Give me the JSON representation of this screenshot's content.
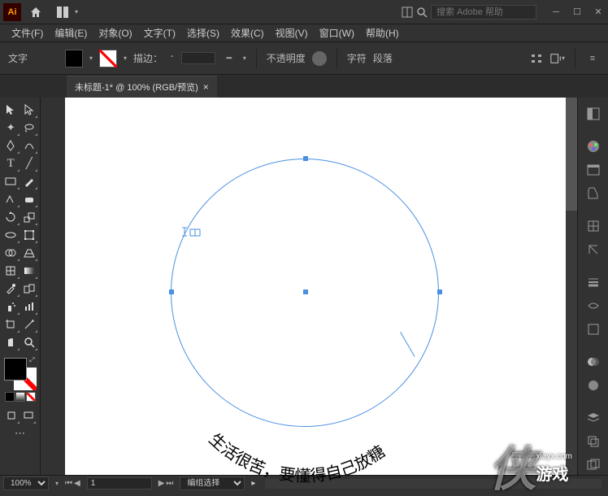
{
  "titlebar": {
    "app_label": "Ai",
    "search_placeholder": "搜索 Adobe 帮助"
  },
  "menus": [
    "文件(F)",
    "编辑(E)",
    "对象(O)",
    "文字(T)",
    "选择(S)",
    "效果(C)",
    "视图(V)",
    "窗口(W)",
    "帮助(H)"
  ],
  "control": {
    "context_label": "文字",
    "stroke_label": "描边：",
    "stroke_weight": "",
    "opacity_label": "不透明度",
    "char_label": "字符",
    "para_label": "段落"
  },
  "doc_tab": {
    "title": "未标题-1* @ 100% (RGB/预览)"
  },
  "canvas": {
    "path_text": "生活很苦，要懂得自己放糖"
  },
  "statusbar": {
    "zoom": "100%",
    "mode": "编组选择",
    "artboard": "1"
  },
  "watermark": {
    "url": "xiayx.com",
    "brand": "游戏"
  }
}
